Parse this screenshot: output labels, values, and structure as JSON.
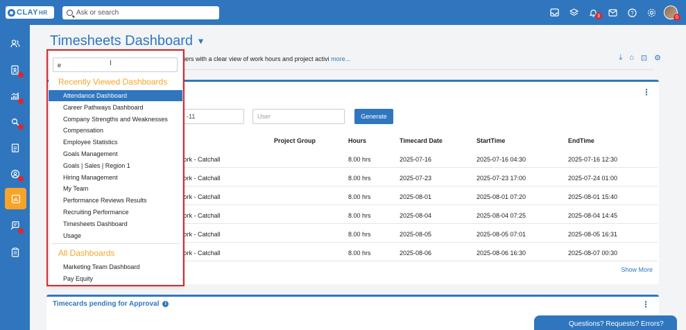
{
  "app": {
    "logo_text": "CLAY",
    "logo_suffix": "HR"
  },
  "search": {
    "placeholder": "Ask or search"
  },
  "topbar": {
    "notification_count": "3",
    "avatar_badge": "0"
  },
  "page": {
    "title": "Timesheets Dashboard",
    "subtitle": "gers with a clear view of work hours and project activi",
    "more_link": "more..."
  },
  "filters": {
    "date_partial": "-11",
    "user_placeholder": "User",
    "generate_label": "Generate"
  },
  "table": {
    "headers": [
      "Project Group",
      "Hours",
      "Timecard Date",
      "StartTime",
      "EndTime"
    ],
    "rows": [
      [
        "/ork - Catchall",
        "8.00 hrs",
        "2025-07-16",
        "2025-07-16 04:30",
        "2025-07-16 12:30"
      ],
      [
        "/ork - Catchall",
        "8.00 hrs",
        "2025-07-23",
        "2025-07-23 17:00",
        "2025-07-24 01:00"
      ],
      [
        "/ork - Catchall",
        "8.00 hrs",
        "2025-08-01",
        "2025-08-01 07:20",
        "2025-08-01 15:40"
      ],
      [
        "/ork - Catchall",
        "8.00 hrs",
        "2025-08-04",
        "2025-08-04 07:25",
        "2025-08-04 14:45"
      ],
      [
        "/ork - Catchall",
        "8.00 hrs",
        "2025-08-05",
        "2025-08-05 07:01",
        "2025-08-05 16:31"
      ],
      [
        "/ork - Catchall",
        "8.00 hrs",
        "2025-08-06",
        "2025-08-06 16:30",
        "2025-08-07 00:30"
      ]
    ],
    "show_more": "Show More"
  },
  "card2": {
    "title": "Timecards pending for Approval"
  },
  "chat": {
    "label": "Questions? Requests? Errors?"
  },
  "dropdown": {
    "query": "e",
    "recent_header": "Recently Viewed Dashboards",
    "recent_items": [
      "Attendance Dashboard",
      "Career Pathways Dashboard",
      "Company Strengths and Weaknesses",
      "Compensation",
      "Employee Statistics",
      "Goals Management",
      "Goals | Sales | Region 1",
      "Hiring Management",
      "My Team",
      "Performance Reviews Results",
      "Recruiting Performance",
      "Timesheets Dashboard",
      "Usage"
    ],
    "all_header": "All Dashboards",
    "all_items": [
      "Marketing Team Dashboard",
      "Pay Equity"
    ]
  },
  "colors": {
    "brand": "#2f76bf",
    "accent": "#f7a428",
    "alert": "#e0262a"
  }
}
